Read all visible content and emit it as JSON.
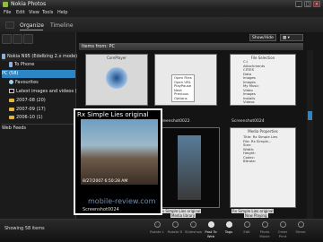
{
  "window": {
    "title": "Nokia Photos",
    "minimize": "_",
    "maximize": "□",
    "close": "×"
  },
  "menu": [
    "File",
    "Edit",
    "View",
    "Tools",
    "Help"
  ],
  "tabs": [
    {
      "label": "Organize"
    },
    {
      "label": "Timeline"
    }
  ],
  "toolbar": {
    "show_hide": "Show/Hide",
    "view_toggle": "▦ ▾"
  },
  "sidebar": {
    "device": "Nokia N95 (Edelbing 2.x mode)",
    "to_phone": "To Phone",
    "items": [
      {
        "label": "PC (58)",
        "selected": true
      },
      {
        "label": "Favourites"
      },
      {
        "label": "Latest images and videos (58)"
      },
      {
        "label": "2007-08 (20)"
      },
      {
        "label": "2007-09 (17)"
      },
      {
        "label": "2006-10 (1)"
      }
    ],
    "web_feeds": "Web Feeds"
  },
  "content": {
    "header": "Items from: PC",
    "thumbs": [
      {
        "title": "CorePlayer",
        "label": ""
      },
      {
        "title": "",
        "label": ""
      },
      {
        "title": "File Selection",
        "label": ""
      },
      {
        "title": "",
        "label": "Screenshot0022"
      },
      {
        "title": "",
        "label": "Screenshot0024"
      },
      {
        "title": "Media Properties",
        "label": "Screenshot0025"
      }
    ],
    "third_list": [
      "C:\\",
      "Attachments",
      "CITIES",
      "Data",
      "Images",
      "Images",
      "My Music",
      "Video",
      "Images",
      "Installs",
      "Videos"
    ],
    "mid_list": [
      "Open Files",
      "Open URL",
      "PlayPause",
      "Next",
      "Previous",
      "Options"
    ],
    "bottom_labels": [
      "Rx Simple Lies original",
      "Media library",
      "Rx Simple Lies original",
      "Now Playing"
    ],
    "media_props": [
      "Title: Rx Simple Lies",
      "File: Rx Simple...",
      "Size: ",
      "Width: ",
      "Height: ",
      "Codec: ",
      "Bitrate: "
    ]
  },
  "preview": {
    "title": "Rx Simple Lies original",
    "timestamp": "8/27/2007 6:50:28 AM",
    "label": "Screenshot0024"
  },
  "status": "Showing 58 items",
  "bottom_tools": [
    {
      "label": "Rotate L"
    },
    {
      "label": "Rotate R"
    },
    {
      "label": "Slideshow"
    },
    {
      "label": "Post To Web",
      "active": true
    },
    {
      "label": "Tags",
      "active": true
    },
    {
      "label": "Edit"
    },
    {
      "label": "Photo Movie"
    },
    {
      "label": "Order Print"
    },
    {
      "label": "Share"
    }
  ],
  "watermark": "mobile-review.com",
  "colors": {
    "accent": "#2c86c6",
    "background": "#161616"
  }
}
